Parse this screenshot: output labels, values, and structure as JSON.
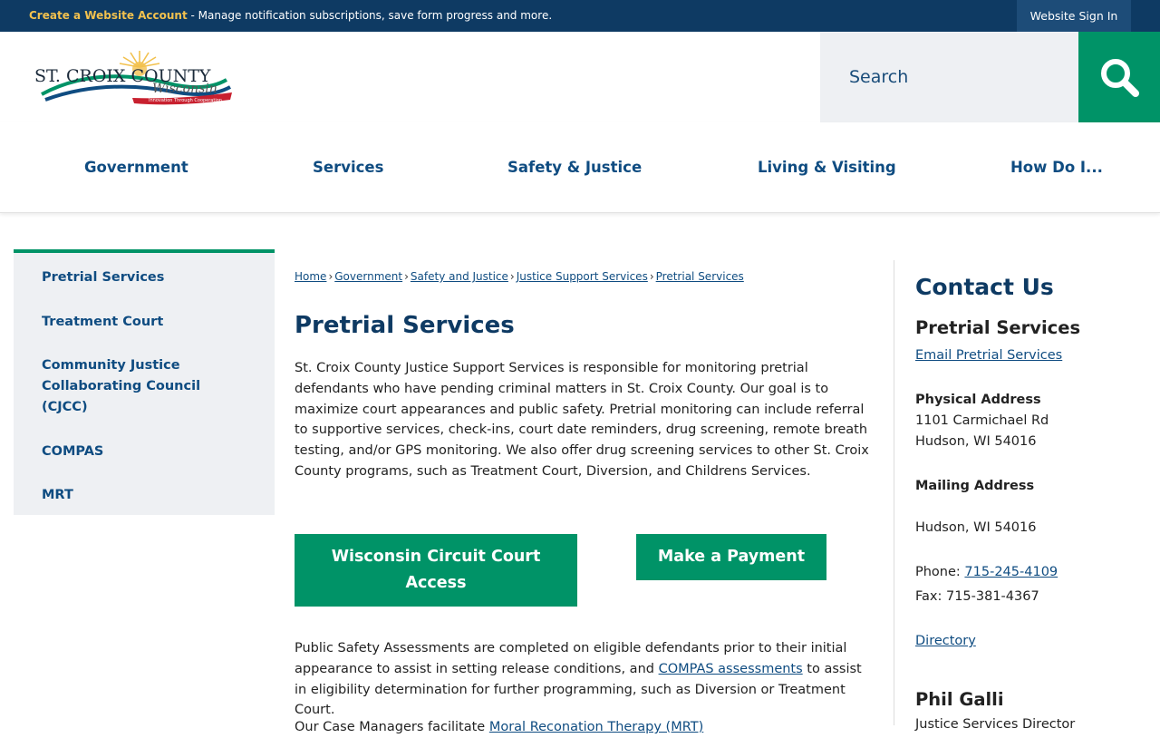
{
  "topbar": {
    "create_account": "Create a Website Account",
    "message": " - Manage notification subscriptions, save form progress and more.",
    "sign_in": "Website Sign In"
  },
  "logo": {
    "line1": "ST. CROIX COUNTY",
    "line2": "Wisconsin",
    "tagline": "Innovation Through Cooperation"
  },
  "search": {
    "placeholder": "Search",
    "icon": "search-icon"
  },
  "nav": {
    "items": [
      "Government",
      "Services",
      "Safety & Justice",
      "Living & Visiting",
      "How Do I..."
    ]
  },
  "sidebar": {
    "items": [
      "Pretrial Services",
      "Treatment Court",
      "Community Justice Collaborating Council (CJCC)",
      "COMPAS",
      "MRT"
    ]
  },
  "breadcrumb": [
    "Home",
    "Government",
    "Safety and Justice",
    "Justice Support Services",
    "Pretrial Services"
  ],
  "main": {
    "title": "Pretrial Services",
    "intro": "St. Croix County Justice Support Services is responsible for monitoring pretrial defendants who have pending criminal matters in St. Croix County. Our goal is to maximize court appearances and public safety. Pretrial monitoring can include referral to supportive services, check-ins, court date reminders, drug screening, remote breath testing, and/or GPS monitoring. We also offer drug screening services to other St. Croix County programs, such as Treatment Court, Diversion, and Childrens Services.",
    "buttons": {
      "circuit_court": "Wisconsin Circuit Court Access",
      "payment": "Make a Payment"
    },
    "assessment_before": "Public Safety Assessments are completed on eligible defendants prior to their initial appearance to assist in setting release conditions, and ",
    "assessment_link": "COMPAS assessments",
    "assessment_after": " to assist in eligibility determination for further programming, such as Diversion or Treatment Court.",
    "next_before": "Our Case Managers facilitate ",
    "next_link": "Moral Reconation Therapy (MRT)"
  },
  "contact": {
    "title": "Contact Us",
    "dept": "Pretrial Services",
    "email": "Email Pretrial Services",
    "physical_label": "Physical Address",
    "physical_line1": "1101 Carmichael Rd",
    "physical_line2": "Hudson, WI 54016",
    "mailing_label": "Mailing Address",
    "mailing_line": "Hudson, WI 54016",
    "phone_label": "Phone: ",
    "phone": "715-245-4109",
    "fax": "Fax: 715-381-4367",
    "directory": "Directory",
    "person": "Phil Galli",
    "person_title": "Justice Services Director"
  },
  "colors": {
    "navy": "#0e3a63",
    "link_blue": "#0f4c81",
    "green": "#009367",
    "gold": "#f2c14e",
    "panel_gray": "#eef0f3"
  }
}
